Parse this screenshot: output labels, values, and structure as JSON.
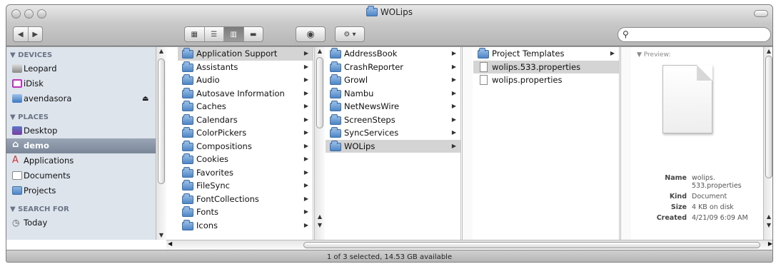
{
  "window": {
    "title": "WOLips"
  },
  "search": {
    "placeholder": ""
  },
  "sidebar": {
    "devices_header": "▼ DEVICES",
    "devices": [
      {
        "label": "Leopard"
      },
      {
        "label": "iDisk"
      },
      {
        "label": "avendasora"
      }
    ],
    "places_header": "▼ PLACES",
    "places": [
      {
        "label": "Desktop"
      },
      {
        "label": "demo"
      },
      {
        "label": "Applications"
      },
      {
        "label": "Documents"
      },
      {
        "label": "Projects"
      }
    ],
    "search_header": "▼ SEARCH FOR",
    "search_items": [
      {
        "label": "Today"
      }
    ]
  },
  "columns": {
    "col1": [
      "Application Support",
      "Assistants",
      "Audio",
      "Autosave Information",
      "Caches",
      "Calendars",
      "ColorPickers",
      "Compositions",
      "Cookies",
      "Favorites",
      "FileSync",
      "FontCollections",
      "Fonts",
      "Icons"
    ],
    "col2": [
      "AddressBook",
      "CrashReporter",
      "Growl",
      "Nambu",
      "NetNewsWire",
      "ScreenSteps",
      "SyncServices",
      "WOLips"
    ],
    "col3": [
      "Project Templates",
      "wolips.533.properties",
      "wolips.properties"
    ]
  },
  "preview": {
    "label": "▼ Preview:",
    "name_key": "Name",
    "name_val": "wolips. 533.properties",
    "kind_key": "Kind",
    "kind_val": "Document",
    "size_key": "Size",
    "size_val": "4 KB on disk",
    "created_key": "Created",
    "created_val": "4/21/09 6:09 AM"
  },
  "status": {
    "text": "1 of 3 selected, 14.53 GB available"
  }
}
